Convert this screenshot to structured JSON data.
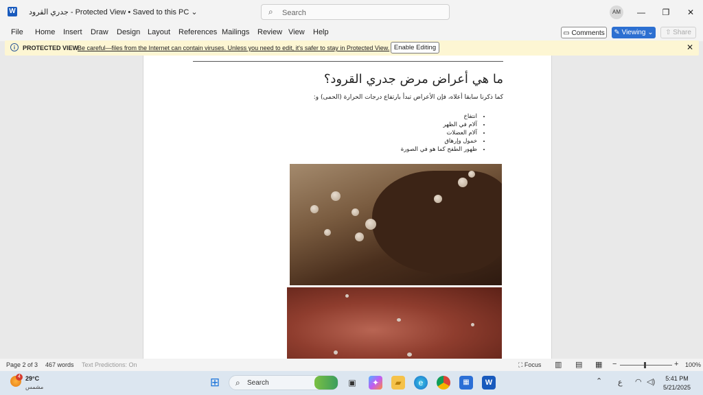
{
  "window": {
    "app_logo": "W",
    "title": "جدري القرود  -  Protected View • Saved to this PC",
    "search_placeholder": "Search",
    "avatar_initials": "AM",
    "controls": {
      "minimize": "—",
      "maximize": "❐",
      "close": "✕"
    }
  },
  "ribbon": {
    "menu": [
      "File",
      "Home",
      "Insert",
      "Draw",
      "Design",
      "Layout",
      "References",
      "Mailings",
      "Review",
      "View",
      "Help"
    ],
    "comments": "Comments",
    "viewing": "Viewing",
    "share": "Share"
  },
  "protected_view": {
    "title": "PROTECTED VIEW",
    "message": "Be careful—files from the Internet can contain viruses. Unless you need to edit, it's safer to stay in Protected View.",
    "button": "Enable Editing"
  },
  "document": {
    "heading": "ما هي أعراض مرض جدري القرود؟",
    "intro": "كما ذكرنا سابقا أعلاه، فإن الأعراض تبدأ بارتفاع درجات الحرارة (الحمى) و:",
    "symptoms": [
      "انتفاخ",
      "آلام في الظهر",
      "آلام العضلات",
      "خمول وإرهاق",
      "ظهور الطفح كما هو في الصورة"
    ]
  },
  "status": {
    "page": "Page 2 of 3",
    "words": "467 words",
    "predictions": "Text Predictions: On",
    "focus": "Focus",
    "zoom": "100%"
  },
  "taskbar": {
    "weather_badge": "4",
    "temperature": "29°C",
    "condition": "مشمس",
    "search_label": "Search",
    "language": "ع",
    "time": "5:41 PM",
    "date": "5/21/2025"
  }
}
